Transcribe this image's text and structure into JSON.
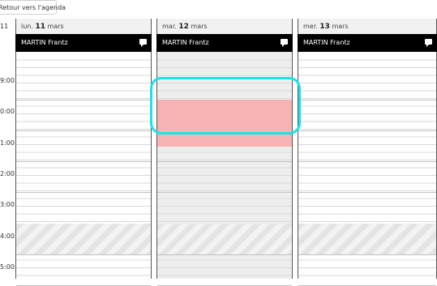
{
  "toolbar": {
    "back_label": "Retour vers l'agenda"
  },
  "week_label": "11",
  "time_labels": [
    "9:00",
    "0:00",
    "1:00",
    "2:00",
    "3:00",
    "4:00",
    "5:00"
  ],
  "days": [
    {
      "prefix": "lun.",
      "num": "11",
      "month": "mars",
      "resource": "MARTIN Frantz"
    },
    {
      "prefix": "mar.",
      "num": "12",
      "month": "mars",
      "resource": "MARTIN Frantz"
    },
    {
      "prefix": "mer.",
      "num": "13",
      "month": "mars",
      "resource": "MARTIN Frantz"
    }
  ],
  "colors": {
    "event_fill": "#f7b3b3",
    "highlight": "#19e3ea",
    "header_bar": "#000000"
  },
  "icons": {
    "resource_note": "chat-bubble-icon"
  }
}
